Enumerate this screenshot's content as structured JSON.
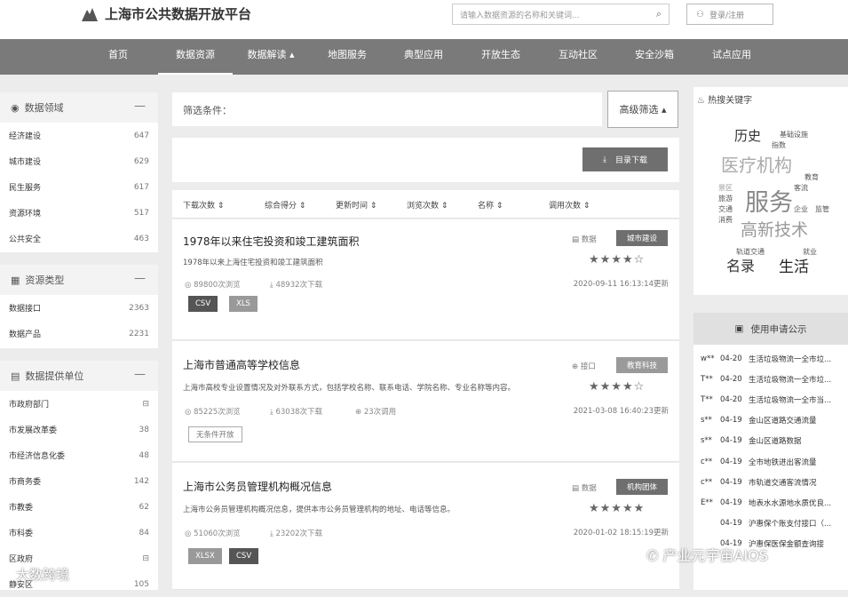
{
  "header": {
    "logo_text": "上海市公共数据开放平台",
    "search_placeholder": "请输入数据资源的名称和关键词...",
    "login_label": "登录/注册"
  },
  "nav": [
    "首页",
    "数据资源",
    "数据解读 ▴",
    "地图服务",
    "典型应用",
    "开放生态",
    "互动社区",
    "安全沙箱",
    "试点应用"
  ],
  "sidebar": {
    "domain": {
      "title": "数据领域",
      "items": [
        {
          "label": "经济建设",
          "count": "647"
        },
        {
          "label": "城市建设",
          "count": "629"
        },
        {
          "label": "民生服务",
          "count": "617"
        },
        {
          "label": "资源环境",
          "count": "517"
        },
        {
          "label": "公共安全",
          "count": "463"
        }
      ]
    },
    "type": {
      "title": "资源类型",
      "items": [
        {
          "label": "数据接口",
          "count": "2363"
        },
        {
          "label": "数据产品",
          "count": "2231"
        }
      ]
    },
    "provider": {
      "title": "数据提供单位",
      "items": [
        {
          "label": "市政府部门",
          "count": "⊟"
        },
        {
          "label": "市发展改革委",
          "count": "38"
        },
        {
          "label": "市经济信息化委",
          "count": "48"
        },
        {
          "label": "市商务委",
          "count": "142"
        },
        {
          "label": "市教委",
          "count": "62"
        },
        {
          "label": "市科委",
          "count": "84"
        },
        {
          "label": "区政府",
          "count": "⊟"
        },
        {
          "label": "静安区",
          "count": "105"
        }
      ]
    }
  },
  "filter": {
    "label": "筛选条件：",
    "advanced": "高级筛选 ▴"
  },
  "download_button": "目录下载",
  "sort": [
    "下载次数",
    "综合得分",
    "更新时间",
    "浏览次数",
    "名称",
    "调用次数"
  ],
  "items": [
    {
      "title": "1978年以来住宅投资和竣工建筑面积",
      "desc": "1978年以来上海住宅投资和竣工建筑面积",
      "views": "89800次浏览",
      "downloads": "48932次下载",
      "calls": "",
      "type": "数据",
      "category": "城市建设",
      "stars": "★★★★☆",
      "date": "2020-09-11 16:13:14更新",
      "formats": [
        "CSV",
        "XLS"
      ]
    },
    {
      "title": "上海市普通高等学校信息",
      "desc": "上海市高校专业设置情况及对外联系方式，包括学校名称、联系电话、学院名称、专业名称等内容。",
      "views": "85225次浏览",
      "downloads": "63038次下载",
      "calls": "23次调用",
      "type": "接口",
      "category": "教育科技",
      "stars": "★★★★☆",
      "date": "2021-03-08 16:40:23更新",
      "formats": [
        "无条件开放"
      ]
    },
    {
      "title": "上海市公务员管理机构概况信息",
      "desc": "上海市公务员管理机构概况信息，提供本市公务员管理机构的地址、电话等信息。",
      "views": "51060次浏览",
      "downloads": "23202次下载",
      "calls": "",
      "type": "数据",
      "category": "机构团体",
      "stars": "★★★★★",
      "date": "2020-01-02 18:15:19更新",
      "formats": [
        "XLSX",
        "CSV"
      ]
    }
  ],
  "hot_keywords": {
    "title": "热搜关键字",
    "words": [
      "历史",
      "基础设施",
      "指数",
      "医疗机构",
      "教育",
      "景区",
      "旅游",
      "交通",
      "消费",
      "服务",
      "客流",
      "企业",
      "监管",
      "高新技术",
      "轨道交通",
      "就业",
      "名录",
      "生活"
    ]
  },
  "apply": {
    "title": "使用申请公示",
    "rows": [
      {
        "user": "w**",
        "date": "04-20",
        "text": "生活垃圾物流一全市垃..."
      },
      {
        "user": "T**",
        "date": "04-20",
        "text": "生活垃圾物流一全市垃..."
      },
      {
        "user": "T**",
        "date": "04-20",
        "text": "生活垃圾物流一全市当..."
      },
      {
        "user": "s**",
        "date": "04-19",
        "text": "金山区道路交通流量"
      },
      {
        "user": "s**",
        "date": "04-19",
        "text": "金山区道路数据"
      },
      {
        "user": "c**",
        "date": "04-19",
        "text": "全市地铁进出客流量"
      },
      {
        "user": "c**",
        "date": "04-19",
        "text": "市轨道交通客流情况"
      },
      {
        "user": "E**",
        "date": "04-19",
        "text": "地表水水源地水质优良..."
      },
      {
        "user": "",
        "date": "04-19",
        "text": "沪惠保个账支付接口（..."
      },
      {
        "user": "",
        "date": "04-19",
        "text": "沪惠保医保金额查询接"
      }
    ]
  },
  "watermarks": [
    "大数跨境",
    "产业元宇宙AIOS"
  ]
}
